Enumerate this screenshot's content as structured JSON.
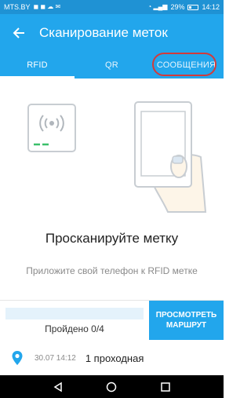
{
  "status_bar": {
    "carrier": "MTS.BY",
    "battery": "29%",
    "time": "14:12"
  },
  "app_bar": {
    "title": "Сканирование меток",
    "back_icon": "arrow-left-icon"
  },
  "tabs": [
    {
      "label": "RFID",
      "active": true
    },
    {
      "label": "QR",
      "active": false
    },
    {
      "label": "СООБЩЕНИЯ",
      "active": false
    }
  ],
  "main": {
    "title": "Просканируйте метку",
    "hint": "Приложите свой телефон к RFID метке"
  },
  "progress": {
    "label": "Пройдено 0/4",
    "fraction": 0.0
  },
  "route_button": {
    "line1": "ПРОСМОТРЕТЬ",
    "line2": "МАРШРУТ"
  },
  "route_item": {
    "date": "30.07 14:12",
    "name": "1 проходная",
    "icon": "location-pin-icon"
  },
  "colors": {
    "primary": "#22a6ec",
    "status": "#1f92d4",
    "highlight": "#d33a3a",
    "tag_green": "#3bbf6a"
  }
}
